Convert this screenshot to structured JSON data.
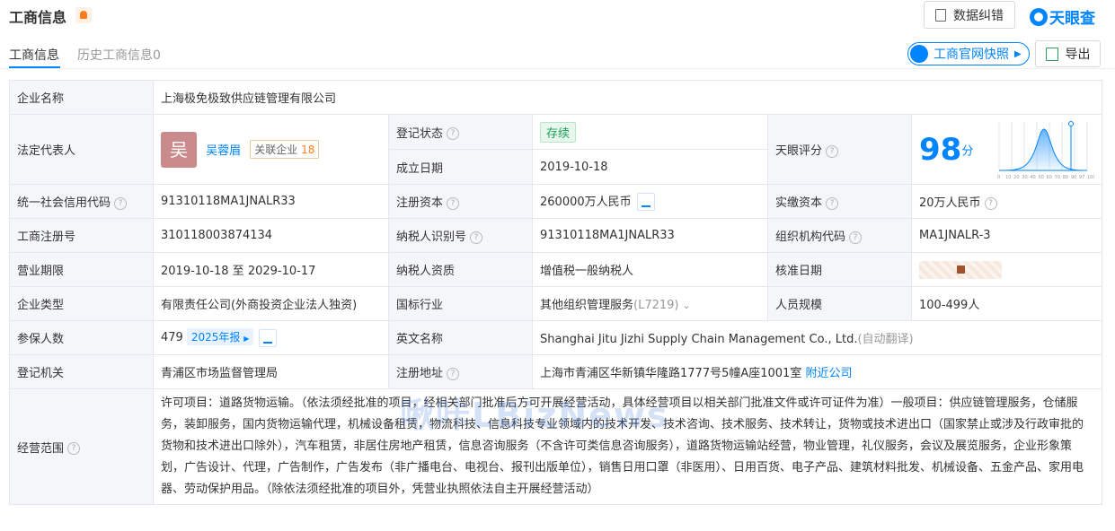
{
  "header": {
    "title": "工商信息",
    "correction_label": "数据纠错",
    "brand": "天眼查"
  },
  "tabs": [
    {
      "label": "工商信息",
      "active": true
    },
    {
      "label": "历史工商信息0",
      "active": false
    }
  ],
  "actions": {
    "snapshot_label": "工商官网快照",
    "export_label": "导出"
  },
  "info": {
    "company_name_label": "企业名称",
    "company_name": "上海极免极致供应链管理有限公司",
    "legal_rep_label": "法定代表人",
    "legal_rep_avatar": "吴",
    "legal_rep_name": "吴蓉眉",
    "related_label": "关联企业",
    "related_count": "18",
    "reg_status_label": "登记状态",
    "reg_status": "存续",
    "founded_label": "成立日期",
    "founded": "2019-10-18",
    "score_label": "天眼评分",
    "score": "98",
    "score_unit": "分",
    "credit_code_label": "统一社会信用代码",
    "credit_code": "91310118MA1JNALR33",
    "reg_capital_label": "注册资本",
    "reg_capital": "260000万人民币",
    "paid_capital_label": "实缴资本",
    "paid_capital": "20万人民币",
    "reg_no_label": "工商注册号",
    "reg_no": "310118003874134",
    "taxpayer_id_label": "纳税人识别号",
    "taxpayer_id": "91310118MA1JNALR33",
    "org_code_label": "组织机构代码",
    "org_code": "MA1JNALR-3",
    "term_label": "营业期限",
    "term": "2019-10-18 至 2029-10-17",
    "taxpayer_qual_label": "纳税人资质",
    "taxpayer_qual": "增值税一般纳税人",
    "approve_date_label": "核准日期",
    "type_label": "企业类型",
    "type": "有限责任公司(外商投资企业法人独资)",
    "industry_label": "国标行业",
    "industry": "其他组织管理服务",
    "industry_code": "(L7219)",
    "staff_label": "人员规模",
    "staff": "100-499人",
    "insured_label": "参保人数",
    "insured": "479",
    "report_label": "2025年报",
    "english_label": "英文名称",
    "english": "Shanghai Jitu Jizhi Supply Chain Management Co., Ltd.",
    "auto_translate": "(自动翻译)",
    "authority_label": "登记机关",
    "authority": "青浦区市场监督管理局",
    "address_label": "注册地址",
    "address": "上海市青浦区华新镇华隆路1777号5幢A座1001室",
    "nearby_label": "附近公司",
    "scope_label": "经营范围",
    "scope": "许可项目：道路货物运输。（依法须经批准的项目，经相关部门批准后方可开展经营活动，具体经营项目以相关部门批准文件或许可证件为准）一般项目：供应链管理服务，仓储服务，装卸服务，国内货物运输代理，机械设备租赁，物流科技、信息科技专业领域内的技术开发、技术咨询、技术服务、技术转让，货物或技术进出口（国家禁止或涉及行政审批的货物和技术进出口除外），汽车租赁，非居住房地产租赁，信息咨询服务（不含许可类信息咨询服务），道路货物运输站经营，物业管理，礼仪服务，会议及展览服务，企业形象策划，广告设计、代理，广告制作，广告发布（非广播电台、电视台、报刊出版单位），销售日用口罩（非医用）、日用百货、电子产品、建筑材料批发、机械设备、五金产品、家用电器、劳动保护用品。（除依法须经批准的项目外，凭营业执照依法自主开展经营活动）"
  },
  "score_chart_ticks": [
    "0",
    "10",
    "20",
    "30",
    "40",
    "50",
    "60",
    "70",
    "80",
    "90",
    "97",
    "100"
  ],
  "watermark": "啾咔LBizNews",
  "colors": {
    "accent": "#0084ff",
    "status_green": "#1ca155",
    "warning": "#ff7a1a"
  }
}
